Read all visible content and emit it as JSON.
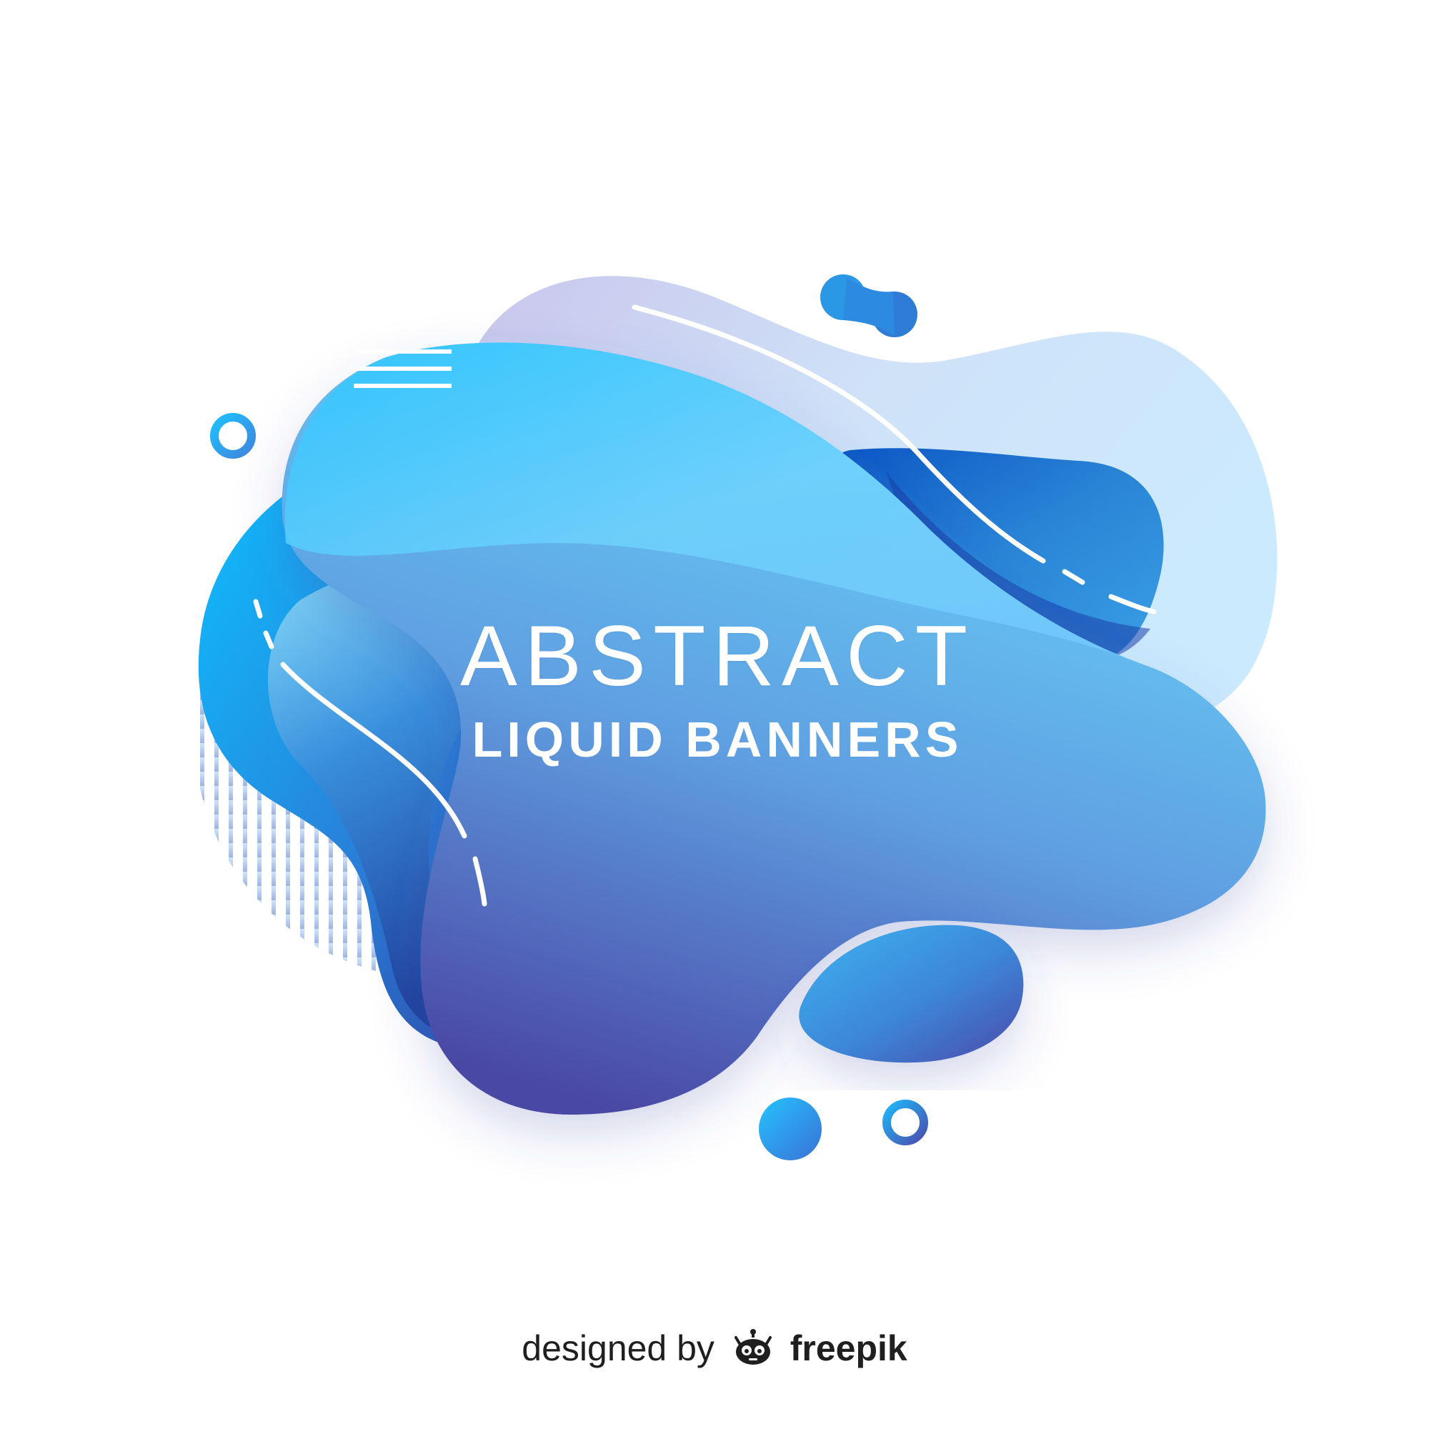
{
  "banner": {
    "title": "ABSTRACT",
    "subtitle": "LIQUID BANNERS"
  },
  "credit": {
    "lead_text": "designed by",
    "brand": "freepik",
    "logo_icon": "robot-head-icon"
  },
  "colors": {
    "background": "#ffffff",
    "cyan": "#2dc6ff",
    "light_blue": "#74ccff",
    "deep_blue": "#1e55b8",
    "indigo": "#4a4aa6",
    "pale_blue": "#cde6fb",
    "text": "#ffffff",
    "credit_text": "#1f1f1f"
  }
}
